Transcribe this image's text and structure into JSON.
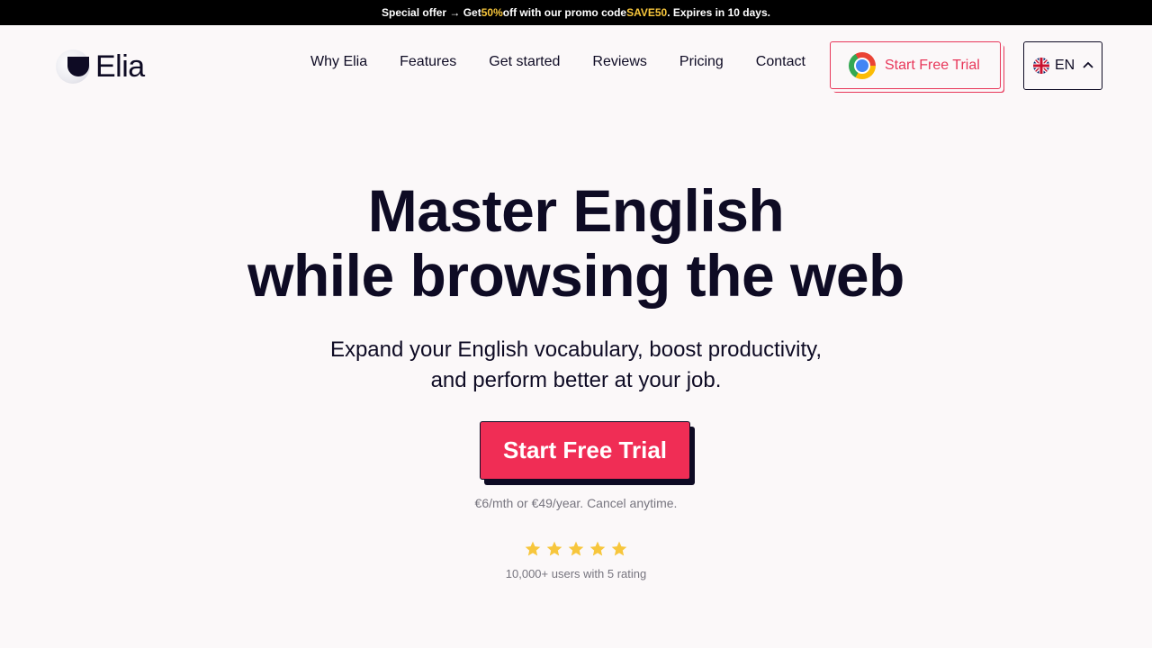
{
  "promo": {
    "lead": "Special offer → Get ",
    "discount": "50%",
    "mid": " off with our promo code ",
    "code": "SAVE50",
    "tail": ". Expires in 10 days.",
    "highlight_color": "#f7c63c"
  },
  "header": {
    "logo_text": "Elia",
    "nav": [
      "Why Elia",
      "Features",
      "Get started",
      "Reviews",
      "Pricing",
      "Contact"
    ],
    "trial_button": {
      "label": "Start Free Trial",
      "icon": "chrome-icon"
    },
    "language": {
      "code": "EN",
      "flag": "uk-flag-icon",
      "chevron": "chevron-up-icon"
    }
  },
  "hero": {
    "title_line1": "Master English",
    "title_line2": "while browsing the web",
    "subtitle_line1": "Expand your English vocabulary, boost productivity,",
    "subtitle_line2": "and perform better at your job.",
    "cta_label": "Start Free Trial",
    "price_note": "€6/mth or €49/year. Cancel anytime.",
    "star_count": 5,
    "rating_text": "10,000+ users with 5 rating"
  },
  "colors": {
    "accent": "#f02d55",
    "text": "#0e0b24",
    "background": "#fbf8f9",
    "star": "#f7c63c"
  }
}
